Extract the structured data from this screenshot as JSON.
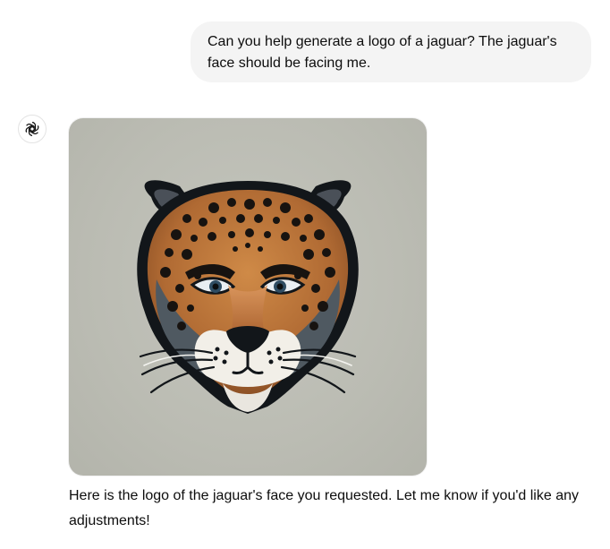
{
  "conversation": {
    "user_message": "Can you help generate a logo of a jaguar? The jaguar's face should be facing me.",
    "assistant_message": "Here is the logo of the jaguar's face you requested. Let me know if you'd like any adjustments!",
    "assistant_avatar_icon": "openai-logo-icon",
    "generated_image_subject": "jaguar-face-logo"
  },
  "colors": {
    "user_bubble": "#f4f4f4",
    "image_background": "#bbbcb3",
    "text": "#0d0d0d",
    "jaguar_fur": "#b8733a",
    "jaguar_outline": "#12161a"
  }
}
